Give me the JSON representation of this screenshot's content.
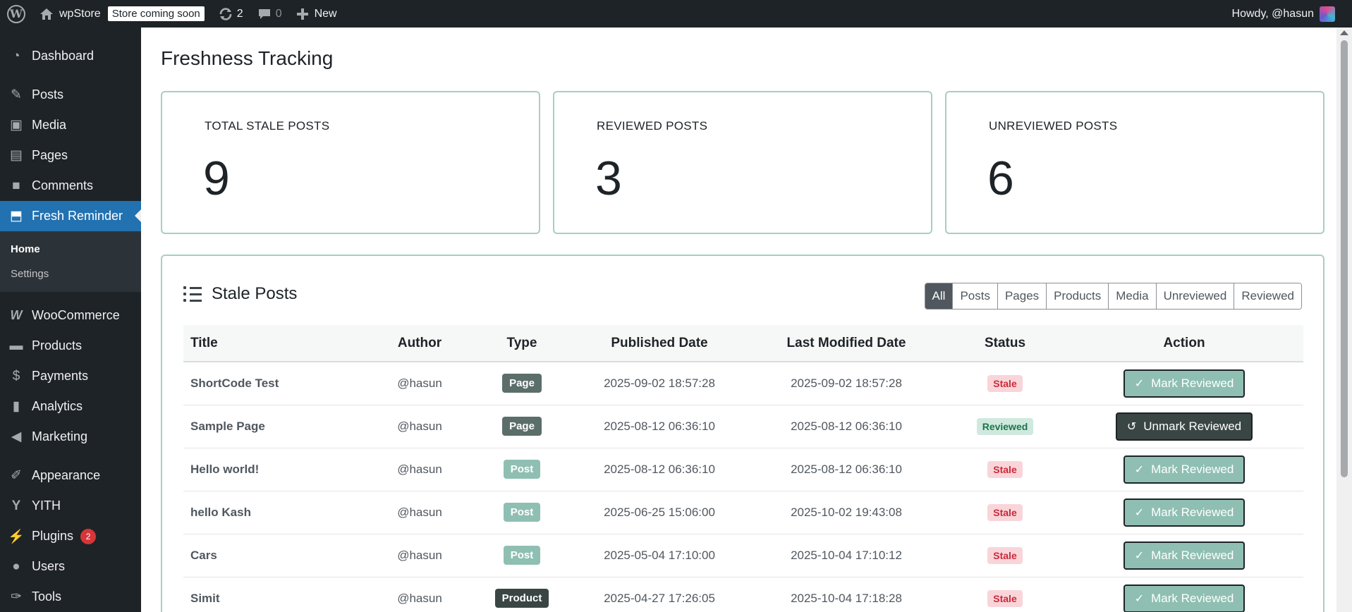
{
  "admin_bar": {
    "site_name": "wpStore",
    "store_badge": "Store coming soon",
    "updates_count": "2",
    "comments_count": "0",
    "new_label": "New",
    "greeting": "Howdy, @hasun",
    "icons": [
      "wordpress-logo-icon",
      "home-icon",
      "updates-icon",
      "comments-icon",
      "plus-icon"
    ]
  },
  "sidebar": {
    "items": [
      {
        "label": "Dashboard",
        "icon": "dashboard-icon"
      },
      {
        "label": "Posts",
        "icon": "pin-icon"
      },
      {
        "label": "Media",
        "icon": "media-icon"
      },
      {
        "label": "Pages",
        "icon": "pages-icon"
      },
      {
        "label": "Comments",
        "icon": "comment-icon"
      },
      {
        "label": "Fresh Reminder",
        "icon": "chart-icon"
      },
      {
        "label": "WooCommerce",
        "icon": "woocommerce-icon"
      },
      {
        "label": "Products",
        "icon": "archive-icon"
      },
      {
        "label": "Payments",
        "icon": "payments-icon"
      },
      {
        "label": "Analytics",
        "icon": "bar-chart-icon"
      },
      {
        "label": "Marketing",
        "icon": "megaphone-icon"
      },
      {
        "label": "Appearance",
        "icon": "brush-icon"
      },
      {
        "label": "YITH",
        "icon": "yith-icon"
      },
      {
        "label": "Plugins",
        "icon": "plug-icon"
      },
      {
        "label": "Users",
        "icon": "user-icon"
      },
      {
        "label": "Tools",
        "icon": "wrench-icon"
      }
    ],
    "submenu": [
      {
        "label": "Home"
      },
      {
        "label": "Settings"
      }
    ],
    "plugins_badge": "2"
  },
  "page": {
    "title": "Freshness Tracking"
  },
  "stats": [
    {
      "label": "TOTAL STALE POSTS",
      "value": "9"
    },
    {
      "label": "REVIEWED POSTS",
      "value": "3"
    },
    {
      "label": "UNREVIEWED POSTS",
      "value": "6"
    }
  ],
  "stale_posts": {
    "title": "Stale Posts",
    "filters": [
      "All",
      "Posts",
      "Pages",
      "Products",
      "Media",
      "Unreviewed",
      "Reviewed"
    ],
    "active_filter": "All",
    "columns": [
      "Title",
      "Author",
      "Type",
      "Published Date",
      "Last Modified Date",
      "Status",
      "Action"
    ],
    "rows": [
      {
        "title": "ShortCode Test",
        "author": "@hasun",
        "type": "Page",
        "published": "2025-09-02 18:57:28",
        "modified": "2025-09-02 18:57:28",
        "status": "Stale",
        "action": "Mark Reviewed"
      },
      {
        "title": "Sample Page",
        "author": "@hasun",
        "type": "Page",
        "published": "2025-08-12 06:36:10",
        "modified": "2025-08-12 06:36:10",
        "status": "Reviewed",
        "action": "Unmark Reviewed"
      },
      {
        "title": "Hello world!",
        "author": "@hasun",
        "type": "Post",
        "published": "2025-08-12 06:36:10",
        "modified": "2025-08-12 06:36:10",
        "status": "Stale",
        "action": "Mark Reviewed"
      },
      {
        "title": "hello Kash",
        "author": "@hasun",
        "type": "Post",
        "published": "2025-06-25 15:06:00",
        "modified": "2025-10-02 19:43:08",
        "status": "Stale",
        "action": "Mark Reviewed"
      },
      {
        "title": "Cars",
        "author": "@hasun",
        "type": "Post",
        "published": "2025-05-04 17:10:00",
        "modified": "2025-10-04 17:10:12",
        "status": "Stale",
        "action": "Mark Reviewed"
      },
      {
        "title": "Simit",
        "author": "@hasun",
        "type": "Product",
        "published": "2025-04-27 17:26:05",
        "modified": "2025-10-04 17:18:28",
        "status": "Stale",
        "action": "Mark Reviewed"
      }
    ]
  },
  "colors": {
    "admin_dark": "#1d2327",
    "accent_blue": "#2271b1",
    "card_border": "#a6cfc5",
    "stale_bg": "#f9d5d9",
    "reviewed_bg": "#cfe9df",
    "mark_button": "#8fbfb2",
    "unmark_button": "#3a4644"
  }
}
